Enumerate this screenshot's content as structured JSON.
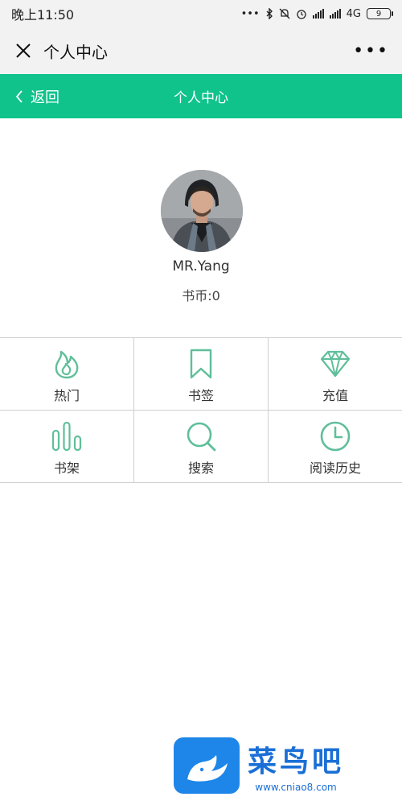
{
  "status_bar": {
    "time": "晚上11:50",
    "network": "4G",
    "battery": "9"
  },
  "titlebar": {
    "title": "个人中心",
    "close_icon": "close-icon",
    "more_icon": "more-icon"
  },
  "header": {
    "back_label": "返回",
    "title": "个人中心",
    "background": "#0fc38b"
  },
  "profile": {
    "username": "MR.Yang",
    "coins": "书币:0"
  },
  "menu": {
    "accent": "#5fbf9a",
    "items": [
      {
        "label": "热门",
        "icon": "flame-icon"
      },
      {
        "label": "书签",
        "icon": "bookmark-icon"
      },
      {
        "label": "充值",
        "icon": "diamond-icon"
      },
      {
        "label": "书架",
        "icon": "bookshelf-icon"
      },
      {
        "label": "搜索",
        "icon": "search-icon"
      },
      {
        "label": "阅读历史",
        "icon": "clock-icon"
      }
    ]
  },
  "watermark": {
    "title": "菜鸟吧",
    "url": "www.cniao8.com"
  }
}
